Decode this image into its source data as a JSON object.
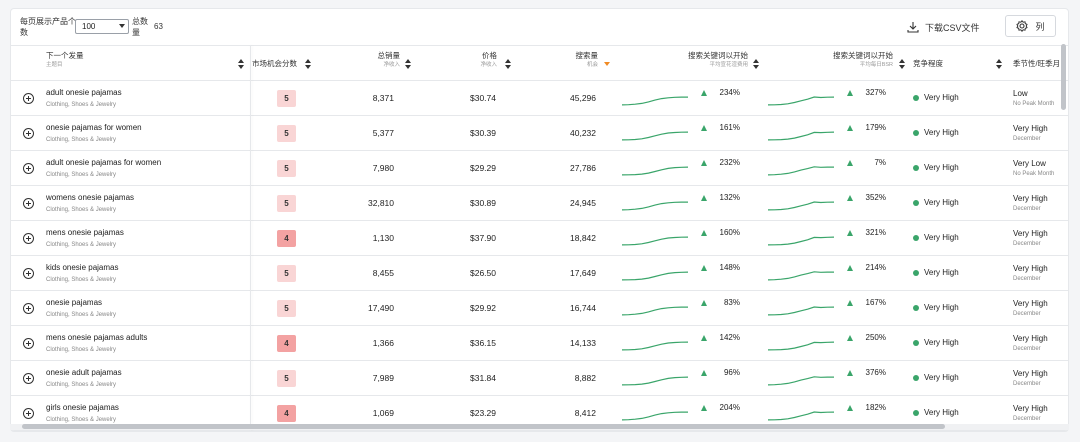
{
  "toolbar": {
    "per_page_label": "每页展示产品个数",
    "per_page_value": "100",
    "total_label": "总数量",
    "total_value": "63",
    "download_label": "下载CSV文件",
    "columns_label": "列"
  },
  "headers": {
    "keyword": "下一个发量",
    "keyword_sub": "主题目",
    "opportunity": "市场机会分数",
    "sales": "总销量",
    "sales_sub": "净收入",
    "price": "价格",
    "price_sub": "净收入",
    "search": "搜索量",
    "search_sub": "机会",
    "trend1": "搜索关键词以开始",
    "trend1_sub": "平均宣花渲费用",
    "trend2": "搜索关键词以开始",
    "trend2_sub": "平均每日BSR",
    "competition": "竞争程度",
    "season": "季节性/旺季月"
  },
  "rows": [
    {
      "keyword": "adult onesie pajamas",
      "category": "Clothing, Shoes & Jewelry",
      "score": "5",
      "sales": "8,371",
      "price": "$30.74",
      "search": "45,296",
      "pct1": "234%",
      "pct2": "327%",
      "competition": "Very High",
      "season": "Low",
      "season_sub": "No Peak Month"
    },
    {
      "keyword": "onesie pajamas for women",
      "category": "Clothing, Shoes & Jewelry",
      "score": "5",
      "sales": "5,377",
      "price": "$30.39",
      "search": "40,232",
      "pct1": "161%",
      "pct2": "179%",
      "competition": "Very High",
      "season": "Very High",
      "season_sub": "December"
    },
    {
      "keyword": "adult onesie pajamas for women",
      "category": "Clothing, Shoes & Jewelry",
      "score": "5",
      "sales": "7,980",
      "price": "$29.29",
      "search": "27,786",
      "pct1": "232%",
      "pct2": "7%",
      "competition": "Very High",
      "season": "Very Low",
      "season_sub": "No Peak Month"
    },
    {
      "keyword": "womens onesie pajamas",
      "category": "Clothing, Shoes & Jewelry",
      "score": "5",
      "sales": "32,810",
      "price": "$30.89",
      "search": "24,945",
      "pct1": "132%",
      "pct2": "352%",
      "competition": "Very High",
      "season": "Very High",
      "season_sub": "December"
    },
    {
      "keyword": "mens onesie pajamas",
      "category": "Clothing, Shoes & Jewelry",
      "score": "4",
      "sales": "1,130",
      "price": "$37.90",
      "search": "18,842",
      "pct1": "160%",
      "pct2": "321%",
      "competition": "Very High",
      "season": "Very High",
      "season_sub": "December"
    },
    {
      "keyword": "kids onesie pajamas",
      "category": "Clothing, Shoes & Jewelry",
      "score": "5",
      "sales": "8,455",
      "price": "$26.50",
      "search": "17,649",
      "pct1": "148%",
      "pct2": "214%",
      "competition": "Very High",
      "season": "Very High",
      "season_sub": "December"
    },
    {
      "keyword": "onesie pajamas",
      "category": "Clothing, Shoes & Jewelry",
      "score": "5",
      "sales": "17,490",
      "price": "$29.92",
      "search": "16,744",
      "pct1": "83%",
      "pct2": "167%",
      "competition": "Very High",
      "season": "Very High",
      "season_sub": "December"
    },
    {
      "keyword": "mens onesie pajamas adults",
      "category": "Clothing, Shoes & Jewelry",
      "score": "4",
      "sales": "1,366",
      "price": "$36.15",
      "search": "14,133",
      "pct1": "142%",
      "pct2": "250%",
      "competition": "Very High",
      "season": "Very High",
      "season_sub": "December"
    },
    {
      "keyword": "onesie adult pajamas",
      "category": "Clothing, Shoes & Jewelry",
      "score": "5",
      "sales": "7,989",
      "price": "$31.84",
      "search": "8,882",
      "pct1": "96%",
      "pct2": "376%",
      "competition": "Very High",
      "season": "Very High",
      "season_sub": "December"
    },
    {
      "keyword": "girls onesie pajamas",
      "category": "Clothing, Shoes & Jewelry",
      "score": "4",
      "sales": "1,069",
      "price": "$23.29",
      "search": "8,412",
      "pct1": "204%",
      "pct2": "182%",
      "competition": "Very High",
      "season": "Very High",
      "season_sub": "December"
    }
  ],
  "colors": {
    "accent_green": "#3aa56a",
    "score_5": "#f9d5d5",
    "score_4": "#f3a2a2",
    "sort_active": "#f08a24"
  }
}
